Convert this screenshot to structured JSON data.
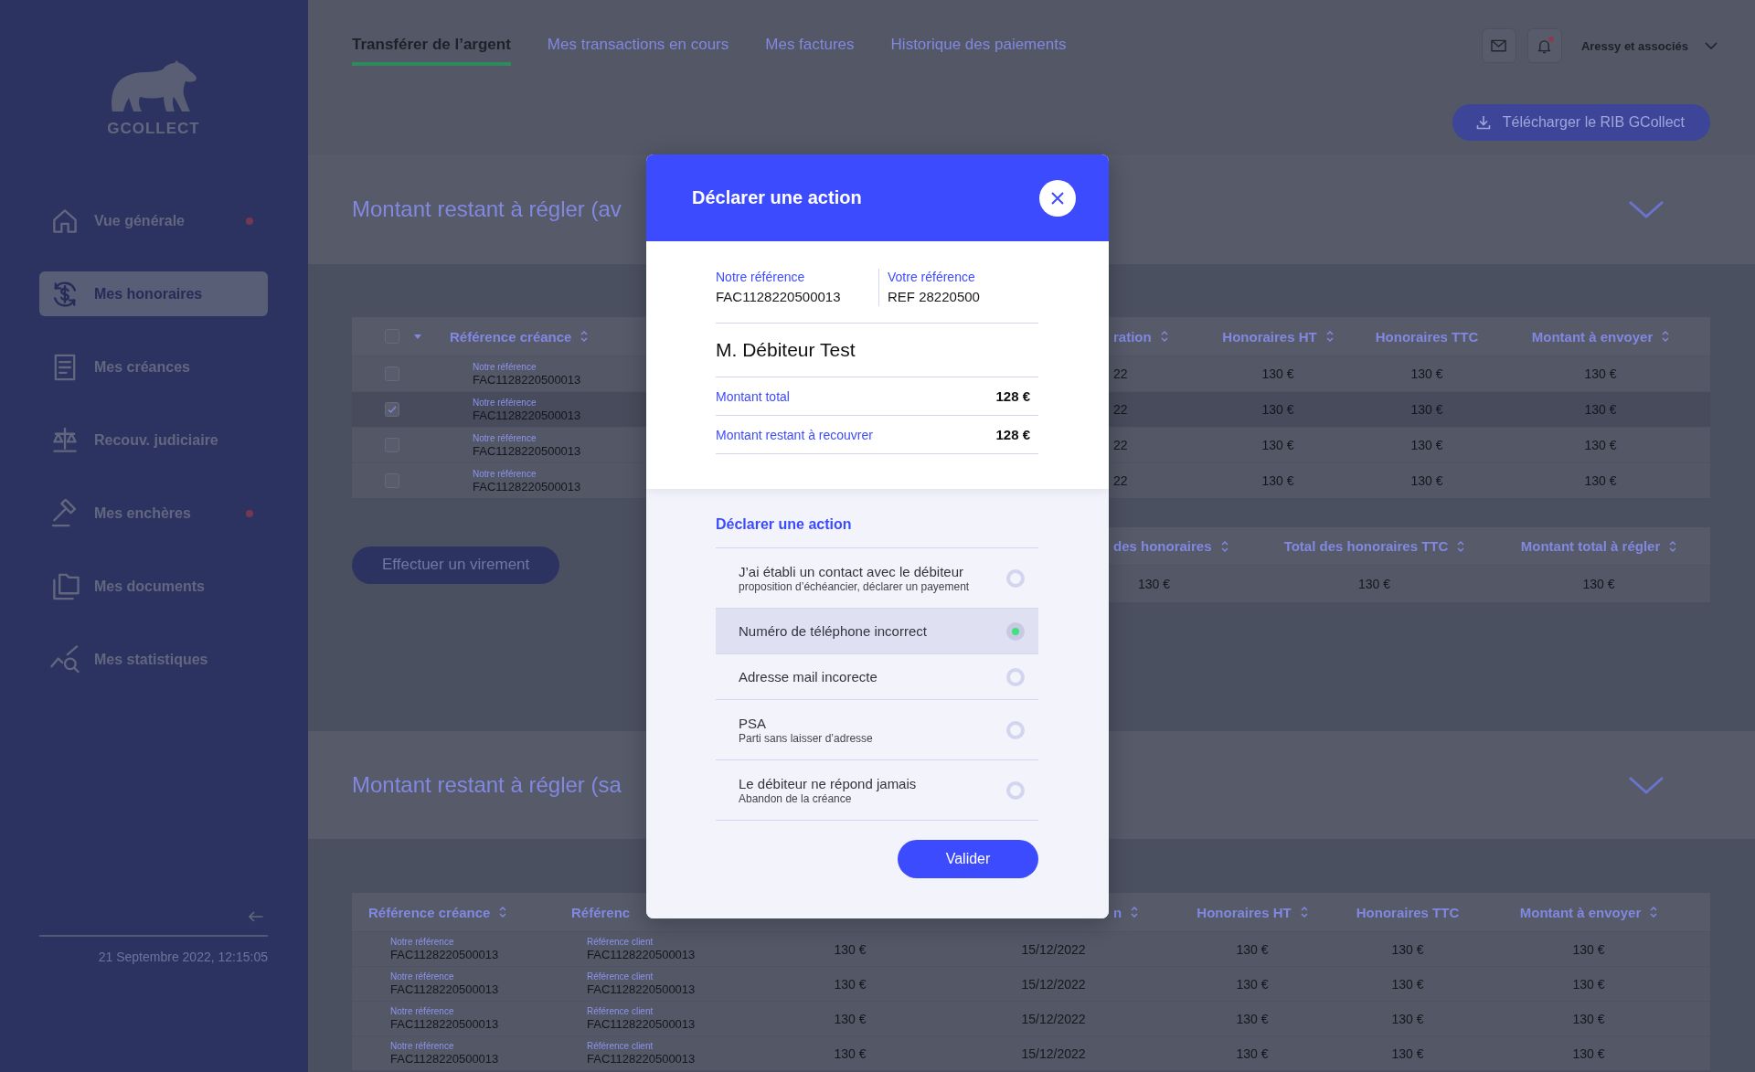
{
  "sidebar": {
    "logo_text": "GCOLLECT",
    "items": [
      {
        "label": "Vue générale",
        "selected": false,
        "notification": true
      },
      {
        "label": "Mes honoraires",
        "selected": true,
        "notification": false
      },
      {
        "label": "Mes créances",
        "selected": false,
        "notification": false
      },
      {
        "label": "Recouv. judiciaire",
        "selected": false,
        "notification": false
      },
      {
        "label": "Mes enchères",
        "selected": false,
        "notification": true
      },
      {
        "label": "Mes documents",
        "selected": false,
        "notification": false
      },
      {
        "label": "Mes statistiques",
        "selected": false,
        "notification": false
      }
    ],
    "date": "21 Septembre 2022, 12:15:05"
  },
  "top_bar": {
    "tabs": [
      {
        "label": "Transférer de l’argent",
        "selected": true
      },
      {
        "label": "Mes transactions en cours",
        "selected": false
      },
      {
        "label": "Mes factures",
        "selected": false
      },
      {
        "label": "Historique des paiements",
        "selected": false
      }
    ],
    "bell_unread": true,
    "account": "Aressy et associés"
  },
  "download_button": "Télécharger le RIB GCollect",
  "sections": [
    {
      "title": "Montant restant à régler (av",
      "table": {
        "kind": "selectable",
        "select_all_checked": false,
        "ref_column": {
          "label": "Référence créance",
          "sortable": true
        },
        "columns": [
          {
            "label": "ration",
            "sortable": true
          },
          {
            "label": "Honoraires HT",
            "sortable": true
          },
          {
            "label": "Honoraires TTC",
            "sortable": false
          },
          {
            "label": "Montant à envoyer",
            "sortable": true
          }
        ],
        "rows": [
          {
            "selected": false,
            "checked": false,
            "ref_label": "Notre référence",
            "ref": "FAC1128220500013",
            "cells": [
              "22",
              "130 €",
              "130 €",
              "130 €"
            ]
          },
          {
            "selected": true,
            "checked": true,
            "ref_label": "Notre référence",
            "ref": "FAC1128220500013",
            "cells": [
              "22",
              "130 €",
              "130 €",
              "130 €"
            ]
          },
          {
            "selected": false,
            "checked": false,
            "ref_label": "Notre référence",
            "ref": "FAC1128220500013",
            "cells": [
              "22",
              "130 €",
              "130 €",
              "130 €"
            ]
          },
          {
            "selected": false,
            "checked": false,
            "ref_label": "Notre référence",
            "ref": "FAC1128220500013",
            "cells": [
              "22",
              "130 €",
              "130 €",
              "130 €"
            ]
          }
        ]
      },
      "transfer_button": "Effectuer un virement",
      "totals": {
        "columns": [
          {
            "label": "des honoraires",
            "sortable": true
          },
          {
            "label": "Total des honoraires TTC",
            "sortable": true
          },
          {
            "label": "Montant total à régler",
            "sortable": true
          }
        ],
        "values": [
          "130 €",
          "130 €",
          "130 €"
        ]
      }
    },
    {
      "title": "Montant restant à régler (sa",
      "table": {
        "kind": "plain",
        "ref_columns": [
          {
            "label": "Référence créance",
            "sortable": true
          },
          {
            "label": "Référenc"
          }
        ],
        "columns": [
          {
            "label": "n",
            "sortable": true
          },
          {
            "label": "Honoraires HT",
            "sortable": true
          },
          {
            "label": "Honoraires TTC",
            "sortable": false
          },
          {
            "label": "Montant à envoyer",
            "sortable": true
          }
        ],
        "rows": [
          {
            "ref_label": "Notre référence",
            "ref": "FAC1128220500013",
            "client_label": "Référence client",
            "client_ref": "FAC1128220500013",
            "column_3": "130 €",
            "cells": [
              "15/12/2022",
              "130 €",
              "130 €",
              "130 €"
            ]
          },
          {
            "ref_label": "Notre référence",
            "ref": "FAC1128220500013",
            "client_label": "Référence client",
            "client_ref": "FAC1128220500013",
            "column_3": "130 €",
            "cells": [
              "15/12/2022",
              "130 €",
              "130 €",
              "130 €"
            ]
          },
          {
            "ref_label": "Notre référence",
            "ref": "FAC1128220500013",
            "client_label": "Référence client",
            "client_ref": "FAC1128220500013",
            "column_3": "130 €",
            "cells": [
              "15/12/2022",
              "130 €",
              "130 €",
              "130 €"
            ]
          },
          {
            "ref_label": "Notre référence",
            "ref": "FAC1128220500013",
            "client_label": "Référence client",
            "client_ref": "FAC1128220500013",
            "column_3": "130 €",
            "cells": [
              "15/12/2022",
              "130 €",
              "130 €",
              "130 €"
            ]
          }
        ]
      }
    }
  ],
  "modal": {
    "title": "Déclarer une action",
    "refs": [
      {
        "label": "Notre référence",
        "value": "FAC1128220500013"
      },
      {
        "label": "Votre référence",
        "value": "REF 28220500"
      }
    ],
    "debtor": "M. Débiteur Test",
    "amounts": [
      {
        "label": "Montant total",
        "value": "128 €"
      },
      {
        "label": "Montant restant à recouvrer",
        "value": "128 €"
      }
    ],
    "action_title": "Déclarer une action",
    "options": [
      {
        "label": "J’ai établi un contact avec le débiteur",
        "hint": "proposition d’échéancier, déclarer un payement",
        "selected": false
      },
      {
        "label": "Numéro de téléphone incorrect",
        "selected": true
      },
      {
        "label": "Adresse mail incorecte",
        "selected": false
      },
      {
        "label": "PSA",
        "hint": "Parti sans laisser d’adresse",
        "selected": false
      },
      {
        "label": "Le débiteur ne répond jamais",
        "hint": "Abandon de la créance",
        "selected": false
      }
    ],
    "submit": "Valider"
  }
}
